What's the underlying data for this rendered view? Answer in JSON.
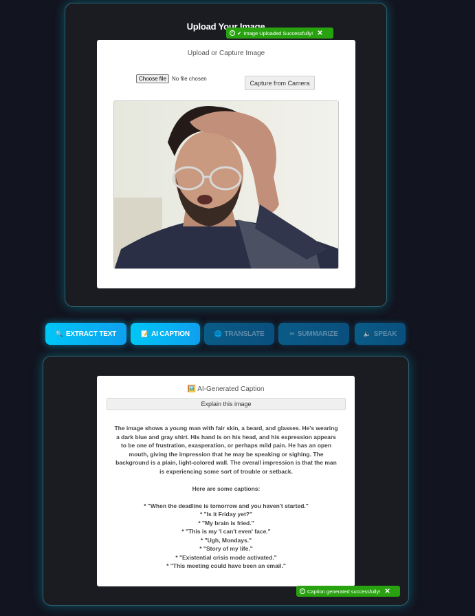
{
  "upload": {
    "title": "Upload Your Image",
    "card_title": "Upload or Capture Image",
    "choose_file_label": "Choose file",
    "file_status": "No file chosen",
    "camera_button": "Capture from Camera",
    "toast": "Image Uploaded Successfully!"
  },
  "actions": [
    {
      "label": "EXTRACT TEXT",
      "icon": "magnifier-icon",
      "glyph": "🔍",
      "state": "active"
    },
    {
      "label": "AI CAPTION",
      "icon": "document-icon",
      "glyph": "📝",
      "state": "active"
    },
    {
      "label": "TRANSLATE",
      "icon": "globe-icon",
      "glyph": "🌐",
      "state": "disabled"
    },
    {
      "label": "SUMMARIZE",
      "icon": "scissors-icon",
      "glyph": "✂",
      "state": "disabled"
    },
    {
      "label": "SPEAK",
      "icon": "speaker-icon",
      "glyph": "🔈",
      "state": "disabled"
    }
  ],
  "caption": {
    "title_icon": "🖼️",
    "title": "AI-Generated Caption",
    "prompt": "Explain this image",
    "description": "The image shows a young man with fair skin, a beard, and glasses. He's wearing a dark blue and gray shirt. His hand is on his head, and his expression appears to be one of frustration, exasperation, or perhaps mild pain. He has an open mouth, giving the impression that he may be speaking or sighing. The background is a plain, light-colored wall. The overall impression is that the man is experiencing some sort of trouble or setback.",
    "captions_heading": "Here are some captions:",
    "captions": [
      "* \"When the deadline is tomorrow and you haven't started.\"",
      "* \"Is it Friday yet?\"",
      "* \"My brain is fried.\"",
      "* \"This is my 'I can't even' face.\"",
      "* \"Ugh, Mondays.\"",
      "* \"Story of my life.\"",
      "* \"Existential crisis mode activated.\"",
      "* \"This meeting could have been an email.\""
    ],
    "toast": "Caption generated successfully!"
  },
  "colors": {
    "background": "#12141f",
    "panel": "#1b1c22",
    "accent": "#00c6f7",
    "success": "#28a30f"
  }
}
